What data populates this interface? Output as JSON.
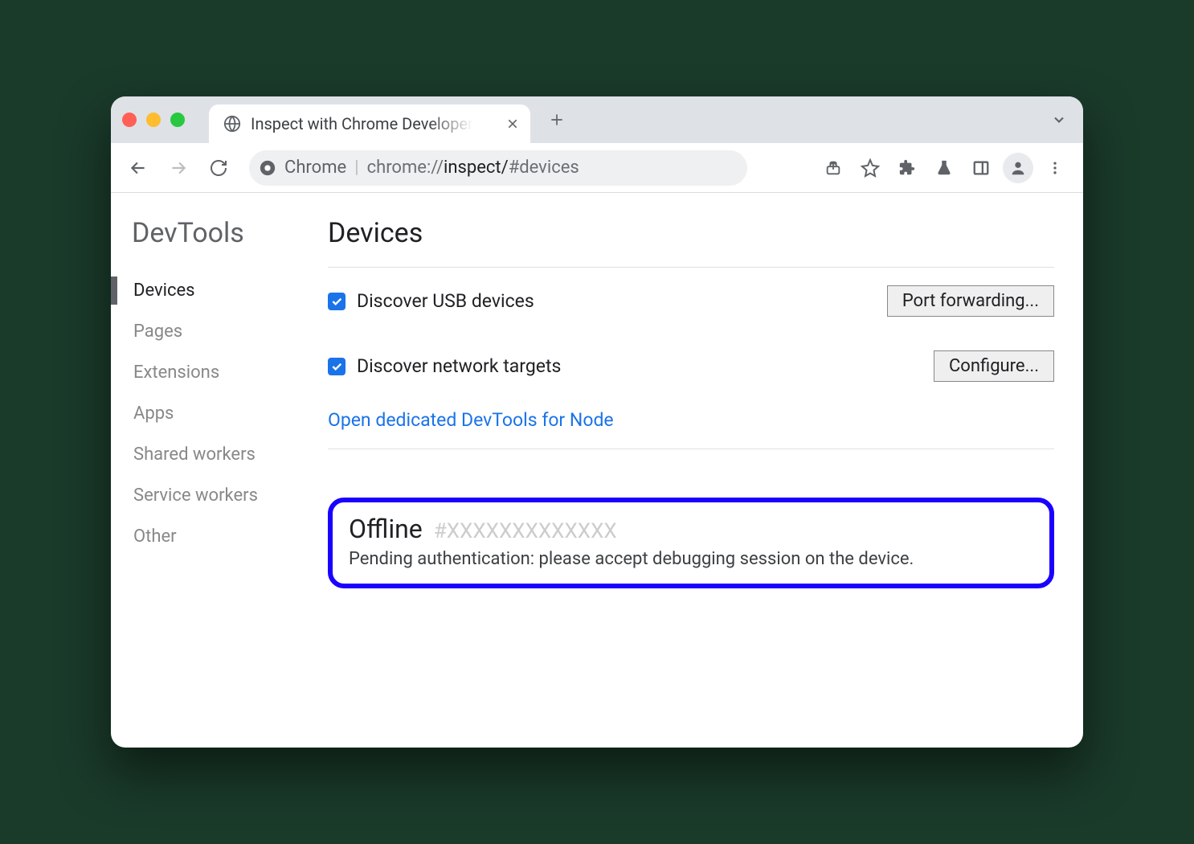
{
  "window": {
    "tab_title": "Inspect with Chrome Developer"
  },
  "omnibox": {
    "scheme_label": "Chrome",
    "url_prefix": "chrome://",
    "url_path": "inspect/",
    "url_hash": "#devices"
  },
  "sidebar": {
    "title": "DevTools",
    "items": [
      {
        "label": "Devices",
        "active": true
      },
      {
        "label": "Pages"
      },
      {
        "label": "Extensions"
      },
      {
        "label": "Apps"
      },
      {
        "label": "Shared workers"
      },
      {
        "label": "Service workers"
      },
      {
        "label": "Other"
      }
    ]
  },
  "main": {
    "heading": "Devices",
    "usb": {
      "label": "Discover USB devices",
      "checked": true,
      "button": "Port forwarding..."
    },
    "network": {
      "label": "Discover network targets",
      "checked": true,
      "button": "Configure..."
    },
    "node_link": "Open dedicated DevTools for Node",
    "device": {
      "status": "Offline",
      "serial": "#XXXXXXXXXXXXX",
      "message": "Pending authentication: please accept debugging session on the device."
    }
  }
}
